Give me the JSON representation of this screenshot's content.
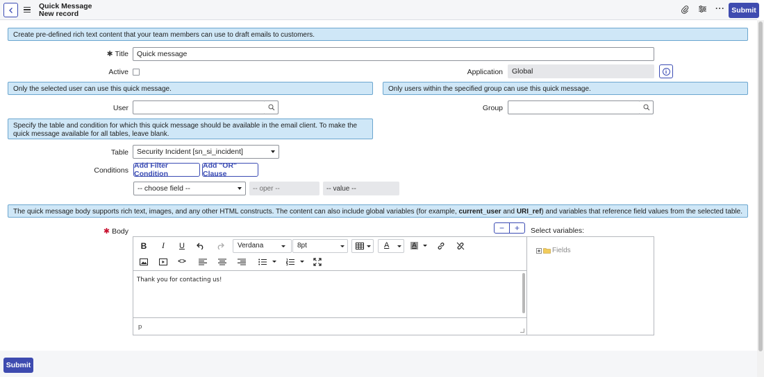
{
  "header": {
    "title": "Quick Message",
    "subtitle": "New record",
    "submit_label": "Submit",
    "icons": [
      "back-icon",
      "menu-icon",
      "attachment-icon",
      "settings-icon",
      "more-icon"
    ]
  },
  "info": {
    "intro": "Create pre-defined rich text content that your team members can use to draft emails to customers.",
    "user_note": "Only the selected user can use this quick message.",
    "group_note": "Only users within the specified group can use this quick message.",
    "table_note": "Specify the table and condition for which this quick message should be available in the email client. To make the quick message available for all tables, leave blank.",
    "body_note_pre": "The quick message body supports rich text, images, and any other HTML constructs. The content can also include global variables (for example, ",
    "body_note_var1": "current_user",
    "body_note_mid": " and ",
    "body_note_var2": "URI_ref",
    "body_note_post": ") and variables that reference field values from the selected table."
  },
  "form": {
    "title_label": "Title",
    "title_value": "Quick message",
    "active_label": "Active",
    "application_label": "Application",
    "application_value": "Global",
    "user_label": "User",
    "group_label": "Group",
    "table_label": "Table",
    "table_value": "Security Incident [sn_si_incident]",
    "conditions_label": "Conditions",
    "add_filter_label": "Add Filter Condition",
    "add_or_label": "Add \"OR\" Clause",
    "choose_field": "-- choose field --",
    "oper": "-- oper --",
    "value": "-- value --",
    "body_label": "Body",
    "select_variables_label": "Select variables:",
    "fields_node": "Fields"
  },
  "editor": {
    "font": "Verdana",
    "size": "8pt",
    "content": "Thank you for contacting us!",
    "path": "p"
  },
  "footer": {
    "submit_label": "Submit"
  },
  "colors": {
    "accent": "#3e4bb0",
    "info_bg": "#cfe7f7",
    "required": "#c8102e"
  }
}
